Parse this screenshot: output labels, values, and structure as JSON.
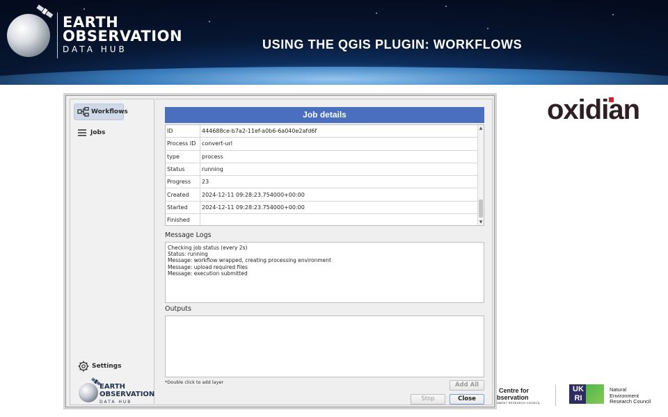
{
  "banner": {
    "brand_line1": "EARTH",
    "brand_line2": "OBSERVATION",
    "brand_line3": "DATA HUB",
    "slide_title": "USING THE QGIS PLUGIN: WORKFLOWS"
  },
  "partner_logo": {
    "text": "oxidian",
    "accent_color": "#d4212f"
  },
  "footer": {
    "ncef_line1": "al Centre for",
    "ncef_line2": "Observation",
    "ncef_line3": "RONMENT RESEARCH COUNCIL",
    "ukri_text": "UK RI",
    "nerc_line1": "Natural",
    "nerc_line2": "Environment",
    "nerc_line3": "Research Council"
  },
  "sidebar": {
    "items": [
      {
        "label": "Workflows",
        "icon": "workflow-icon",
        "active": true
      },
      {
        "label": "Jobs",
        "icon": "hamburger-icon",
        "active": false
      }
    ],
    "settings_label": "Settings",
    "logo_line1": "EARTH",
    "logo_line2": "OBSERVATION",
    "logo_line3": "DATA HUB"
  },
  "job_details": {
    "title": "Job details",
    "rows": [
      {
        "key": "ID",
        "value": "444688ce-b7a2-11ef-a0b6-6a040e2afd6f"
      },
      {
        "key": "Process ID",
        "value": "convert-url"
      },
      {
        "key": "type",
        "value": "process"
      },
      {
        "key": "Status",
        "value": "running"
      },
      {
        "key": "Progress",
        "value": "23"
      },
      {
        "key": "Created",
        "value": "2024-12-11 09:28:23.754000+00:00"
      },
      {
        "key": "Started",
        "value": "2024-12-11 09:28:23.754000+00:00"
      },
      {
        "key": "Finished",
        "value": ""
      }
    ]
  },
  "message_logs": {
    "label": "Message Logs",
    "lines": [
      "Checking job status (every 2s)",
      "",
      "Status: running",
      "Message: workflow wrapped, creating processing environment",
      "Message: upload required files",
      "Message: execution submitted"
    ]
  },
  "outputs": {
    "label": "Outputs",
    "hint": "*Double click to add layer"
  },
  "buttons": {
    "add_all": "Add All",
    "stop": "Stop",
    "close": "Close"
  },
  "colors": {
    "header_blue": "#4a6fbf",
    "banner_dark": "#071631"
  }
}
